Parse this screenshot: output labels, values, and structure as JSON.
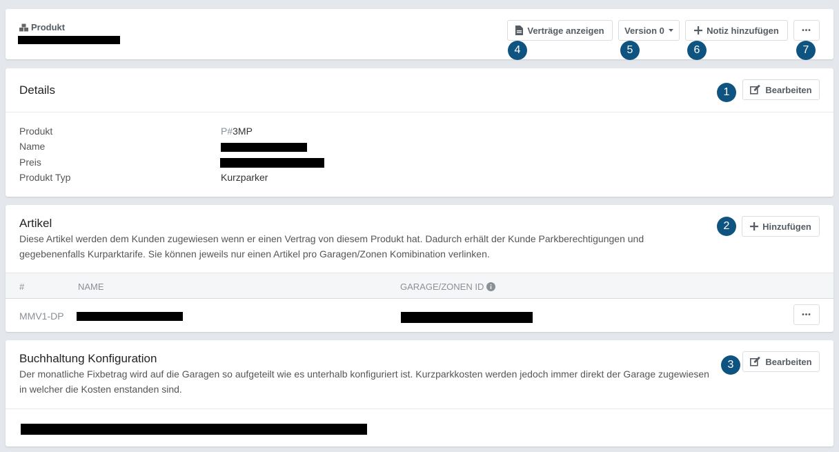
{
  "header": {
    "product_label": "Produkt",
    "buttons": {
      "contracts": "Verträge anzeigen",
      "version": "Version 0",
      "add_note": "Notiz hinzufügen",
      "more": "•••"
    },
    "badges": [
      "4",
      "5",
      "6",
      "7"
    ]
  },
  "details": {
    "title": "Details",
    "edit_label": "Bearbeiten",
    "badge": "1",
    "rows": [
      {
        "label": "Produkt",
        "prefix": "P#",
        "value": "3MP"
      },
      {
        "label": "Name"
      },
      {
        "label": "Preis"
      },
      {
        "label": "Produkt Typ",
        "value": "Kurzparker"
      }
    ]
  },
  "artikel": {
    "title": "Artikel",
    "add_label": "Hinzufügen",
    "badge": "2",
    "description": "Diese Artikel werden dem Kunden zugewiesen wenn er einen Vertrag von diesem Produkt hat. Dadurch erhält der Kunde Parkberechtigungen und gegebenenfalls Kurparktarife. Sie können jeweils nur einen Artikel pro Garagen/Zonen Komibination verlinken.",
    "columns": {
      "id": "#",
      "name": "NAME",
      "garage": "GARAGE/ZONEN ID"
    },
    "rows": [
      {
        "id": "MMV1-DP",
        "more": "•••"
      }
    ]
  },
  "buchhaltung": {
    "title": "Buchhaltung Konfiguration",
    "edit_label": "Bearbeiten",
    "badge": "3",
    "description": "Der monatliche Fixbetrag wird auf die Garagen so aufgeteilt wie es unterhalb konfiguriert ist. Kurzparkkosten werden jedoch immer direkt der Garage zugewiesen in welcher die Kosten enstanden sind."
  },
  "colors": {
    "badge": "#0f5480",
    "background": "#e4e7ec",
    "redaction": "#000000"
  }
}
